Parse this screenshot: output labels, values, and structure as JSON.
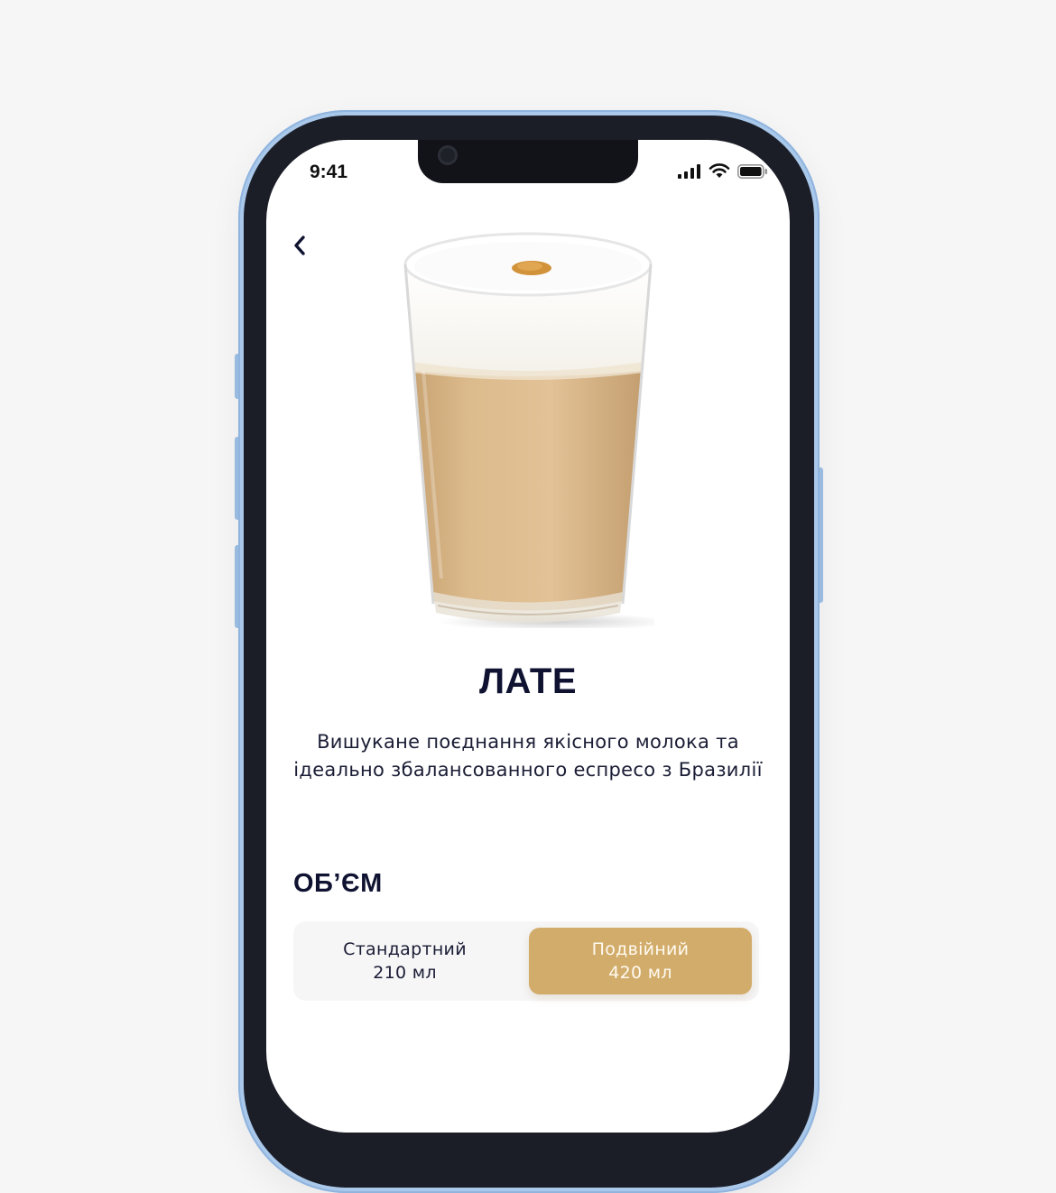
{
  "status_bar": {
    "time": "9:41",
    "signal_icon": "cellular-signal-icon",
    "wifi_icon": "wifi-icon",
    "battery_icon": "battery-icon"
  },
  "navigation": {
    "back_icon": "chevron-left-icon"
  },
  "product": {
    "image": "latte-glass",
    "title": "ЛАТЕ",
    "description": "Вишукане поєднання якісного молока та ідеально збалансованного еспресо з Бразилії"
  },
  "volume": {
    "label": "ОБ’ЄМ",
    "options": [
      {
        "name": "Стандартний",
        "amount": "210 мл",
        "selected": false
      },
      {
        "name": "Подвійний",
        "amount": "420 мл",
        "selected": true
      }
    ]
  },
  "colors": {
    "accent": "#D2AC6B",
    "text_dark": "#0F1331",
    "frame": "#A9C8EA"
  }
}
